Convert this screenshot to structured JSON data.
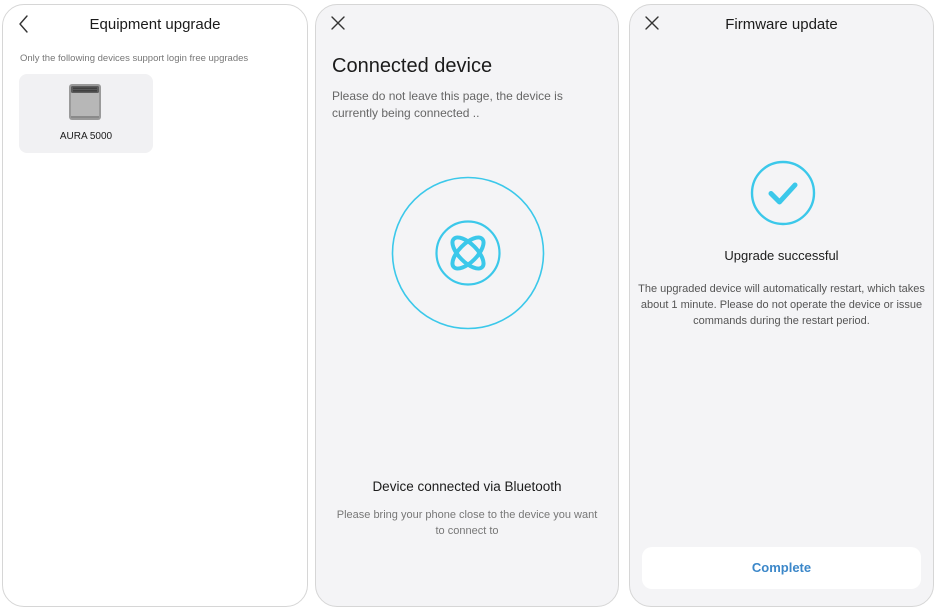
{
  "upgrade_list": {
    "title": "Equipment upgrade",
    "subtitle": "Only the following devices support login free upgrades",
    "devices": [
      {
        "name": "AURA 5000",
        "icon": "device-icon"
      }
    ]
  },
  "connect": {
    "title": "Connected device",
    "subtitle": "Please do not leave this page, the device is currently being connected ..",
    "status": "Device connected via Bluetooth",
    "hint": "Please bring your phone close to the device you want to connect to",
    "icon": "bluetooth-connect-icon"
  },
  "firmware": {
    "title": "Firmware update",
    "status": "Upgrade successful",
    "description": "The upgraded device will automatically restart, which takes about 1 minute. Please do not operate the device or issue commands during the restart period.",
    "complete_label": "Complete",
    "icon": "checkmark-icon"
  },
  "colors": {
    "accent": "#3bc8ea",
    "button_text": "#3b87c9",
    "screen_bg": "#f4f4f6"
  }
}
